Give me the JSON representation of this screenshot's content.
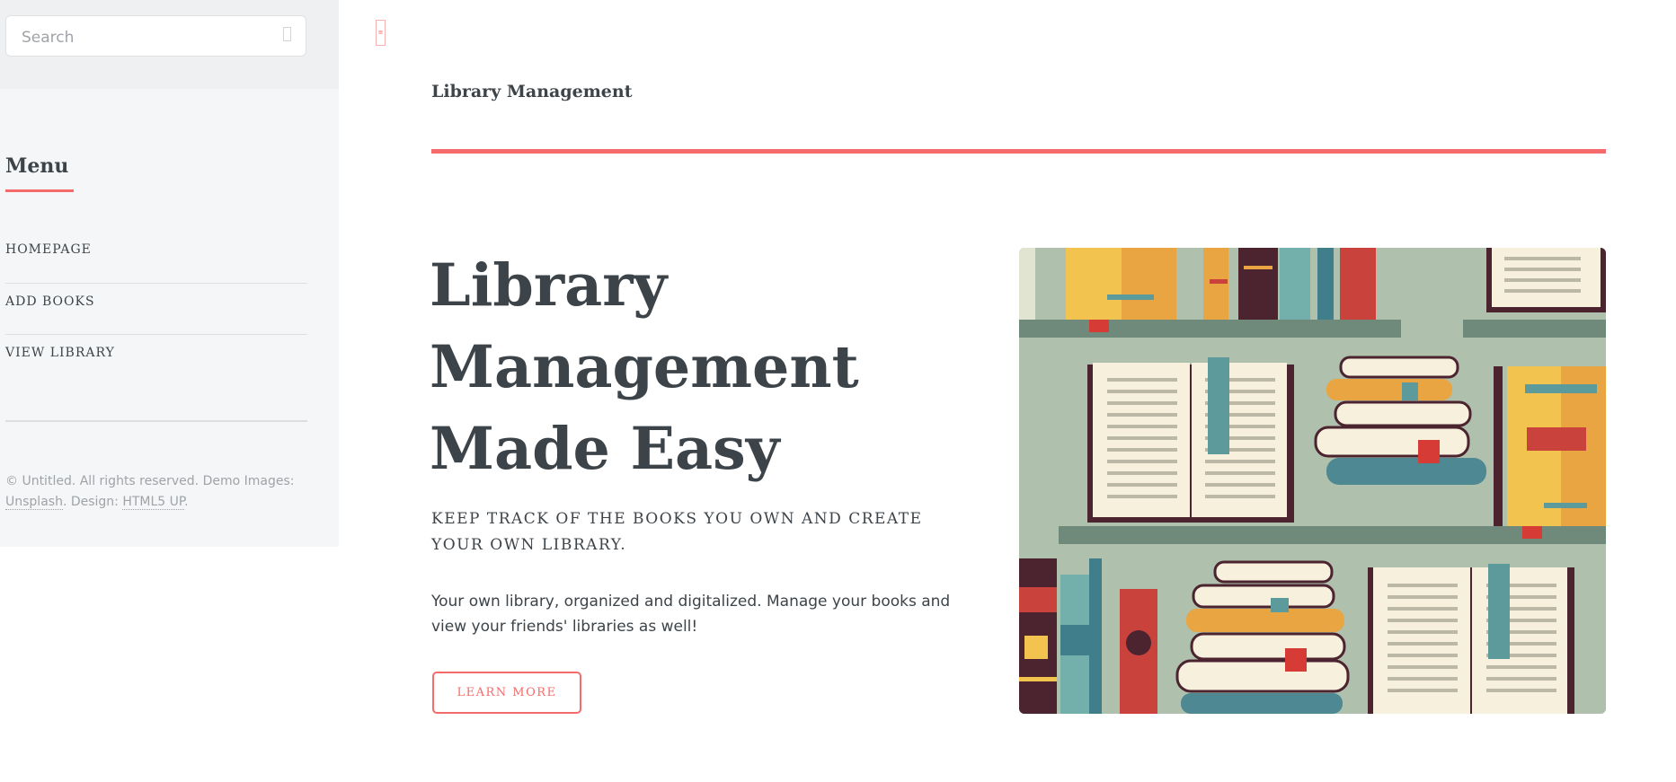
{
  "search": {
    "placeholder": "Search"
  },
  "sidebar": {
    "menu_title": "Menu",
    "items": [
      {
        "label": "HOMEPAGE"
      },
      {
        "label": "ADD BOOKS"
      },
      {
        "label": "VIEW LIBRARY"
      }
    ],
    "footer": {
      "prefix": "© Untitled. All rights reserved. Demo Images: ",
      "link1": "Unsplash",
      "middle": ". Design: ",
      "link2": "HTML5 UP",
      "suffix": "."
    }
  },
  "header": {
    "title": "Library Management"
  },
  "hero": {
    "heading_lines": [
      "Library",
      "Management",
      "Made Easy"
    ],
    "subhead": "KEEP TRACK OF THE BOOKS YOU OWN AND CREATE YOUR OWN LIBRARY.",
    "body": "Your own library, organized and digitalized. Manage your books and view your friends' libraries as well!",
    "button": "LEARN MORE",
    "image_icon": "bookshelf-illustration"
  },
  "colors": {
    "accent": "#f56a6a",
    "text": "#3d4449",
    "sidebar_bg": "#f5f6f7",
    "illustration_bg": "#afc0ad"
  }
}
